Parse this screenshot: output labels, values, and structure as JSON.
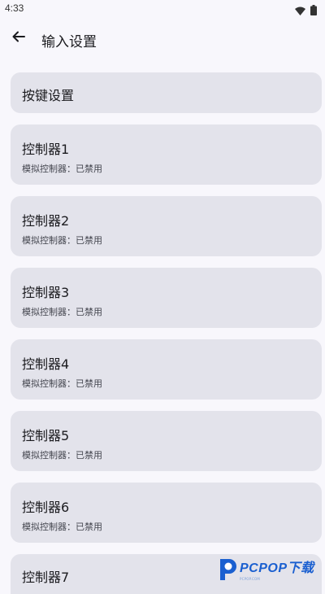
{
  "status_bar": {
    "time": "4:33",
    "icons": [
      "wifi-icon",
      "battery-icon"
    ]
  },
  "app_bar": {
    "back_icon": "arrow-left-icon",
    "title": "输入设置"
  },
  "key_settings": {
    "title": "按键设置"
  },
  "controllers": [
    {
      "title": "控制器1",
      "subtitle": "模拟控制器：已禁用"
    },
    {
      "title": "控制器2",
      "subtitle": "模拟控制器：已禁用"
    },
    {
      "title": "控制器3",
      "subtitle": "模拟控制器：已禁用"
    },
    {
      "title": "控制器4",
      "subtitle": "模拟控制器：已禁用"
    },
    {
      "title": "控制器5",
      "subtitle": "模拟控制器：已禁用"
    },
    {
      "title": "控制器6",
      "subtitle": "模拟控制器：已禁用"
    },
    {
      "title": "控制器7"
    }
  ],
  "watermark": {
    "text": "PCPOP下载",
    "subtext": "PCPOP.COM"
  },
  "colors": {
    "background": "#f8f7fc",
    "card": "#e3e3eb",
    "text": "#1b1b1f",
    "subtext": "#44464f",
    "watermark": "#1a5fd0"
  }
}
